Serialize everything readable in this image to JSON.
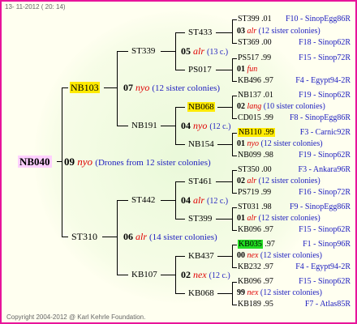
{
  "header": {
    "date": "13- 11-2012 ( 20: 14)"
  },
  "footer": {
    "copyright": "Copyright 2004-2012 @ Karl Kehrle Foundation."
  },
  "root": {
    "name": "NB040",
    "gen_num": "09",
    "group": "nyo",
    "note": "(Drones from 12 sister colonies)"
  },
  "gen1": [
    {
      "name": "NB103",
      "gen_num": "07",
      "group": "nyo",
      "note": "(12 sister colonies)"
    },
    {
      "name": "ST310",
      "gen_num": "06",
      "group": "alr",
      "note": "(14 sister colonies)"
    }
  ],
  "gen2": [
    {
      "name": "ST339",
      "gen_num": "05",
      "group": "alr",
      "note": "(13 c.)"
    },
    {
      "name": "NB191",
      "gen_num": "04",
      "group": "nyo",
      "note": "(12 c.)"
    },
    {
      "name": "ST442",
      "gen_num": "04",
      "group": "alr",
      "note": "(12 c.)"
    },
    {
      "name": "KB107",
      "gen_num": "02",
      "group": "nex",
      "note": "(12 c.)"
    }
  ],
  "gen3": [
    {
      "name": "ST433"
    },
    {
      "name": "PS017"
    },
    {
      "name": "NB068"
    },
    {
      "name": "NB154"
    },
    {
      "name": "ST461"
    },
    {
      "name": "ST399"
    },
    {
      "name": "KB437"
    },
    {
      "name": "KB068"
    }
  ],
  "gen4_groups": [
    {
      "num": "03",
      "group": "alr",
      "note": "(12 sister colonies)"
    },
    {
      "num": "01",
      "group": "fun",
      "note": ""
    },
    {
      "num": "02",
      "group": "lang",
      "note": "(10 sister colonies)"
    },
    {
      "num": "04",
      "group": "nyo",
      "note": "(12 c.)"
    },
    {
      "num": "01",
      "group": "nyo",
      "note": "(12 sister colonies)"
    },
    {
      "num": "02",
      "group": "alr",
      "note": "(12 sister colonies)"
    },
    {
      "num": "01",
      "group": "alr",
      "note": "(12 sister colonies)"
    },
    {
      "num": "00",
      "group": "nex",
      "note": "(12 sister colonies)"
    },
    {
      "num": "99",
      "group": "nex",
      "note": "(12 sister colonies)"
    }
  ],
  "gen4_rows": [
    {
      "name": "ST399",
      "year": ".01",
      "pedigree": "F10 - SinopEgg86R"
    },
    {
      "name": "ST369",
      "year": ".00",
      "pedigree": "F18 - Sinop62R"
    },
    {
      "name": "PS517",
      "year": ".99",
      "pedigree": "F15 - Sinop72R"
    },
    {
      "name": "KB496",
      "year": ".97",
      "pedigree": "F4 - Egypt94-2R"
    },
    {
      "name": "NB137",
      "year": ".01",
      "pedigree": "F19 - Sinop62R"
    },
    {
      "name": "CD015",
      "year": ".99",
      "pedigree": "F8 - SinopEgg86R"
    },
    {
      "name": "NB110",
      "year": ".99",
      "pedigree": "F3 - Carnic92R"
    },
    {
      "name": "NB099",
      "year": ".98",
      "pedigree": "F19 - Sinop62R"
    },
    {
      "name": "ST350",
      "year": ".00",
      "pedigree": "F3 - Ankara96R"
    },
    {
      "name": "PS719",
      "year": ".99",
      "pedigree": "F16 - Sinop72R"
    },
    {
      "name": "ST031",
      "year": ".98",
      "pedigree": "F9 - SinopEgg86R"
    },
    {
      "name": "KB096",
      "year": ".97",
      "pedigree": "F15 - Sinop62R"
    },
    {
      "name": "KB035",
      "year": ".97",
      "pedigree": "F1 - Sinop96R"
    },
    {
      "name": "KB232",
      "year": ".97",
      "pedigree": "F4 - Egypt94-2R"
    },
    {
      "name": "KB096",
      "year": ".97",
      "pedigree": "F15 - Sinop62R"
    },
    {
      "name": "KB189",
      "year": ".95",
      "pedigree": "F7 - Atlas85R"
    }
  ],
  "colors": {
    "frame": "#e8149a",
    "group_text": "#e00000",
    "note_text": "#2020c0",
    "highlight_yellow": "#ffea00",
    "highlight_green": "#22dd22"
  }
}
